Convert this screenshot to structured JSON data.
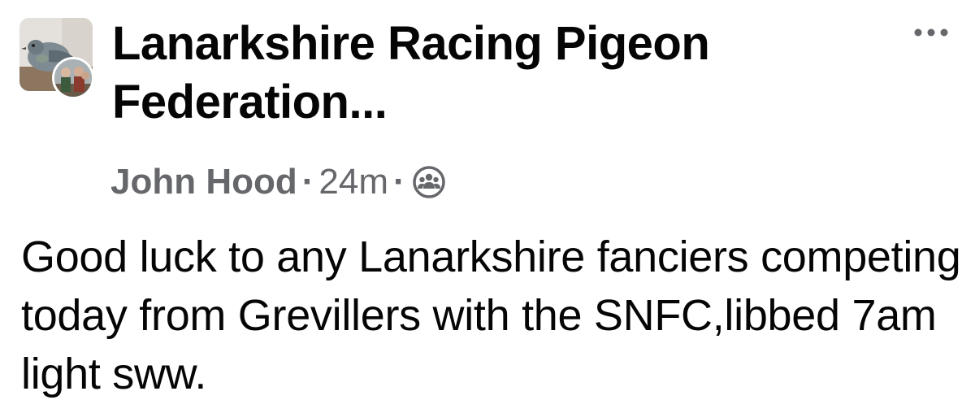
{
  "post": {
    "group_name": "Lanarkshire Racing Pigeon Federation...",
    "author": "John Hood",
    "separator": "·",
    "time_ago": "24m",
    "body": "Good luck to any Lanarkshire fanciers competing today from Grevillers with the SNFC,libbed 7am light sww."
  },
  "icons": {
    "more": "more-horizontal-icon",
    "audience": "group-audience-icon"
  },
  "colors": {
    "primary_text": "#050505",
    "secondary_text": "#65676b",
    "background": "#ffffff"
  }
}
